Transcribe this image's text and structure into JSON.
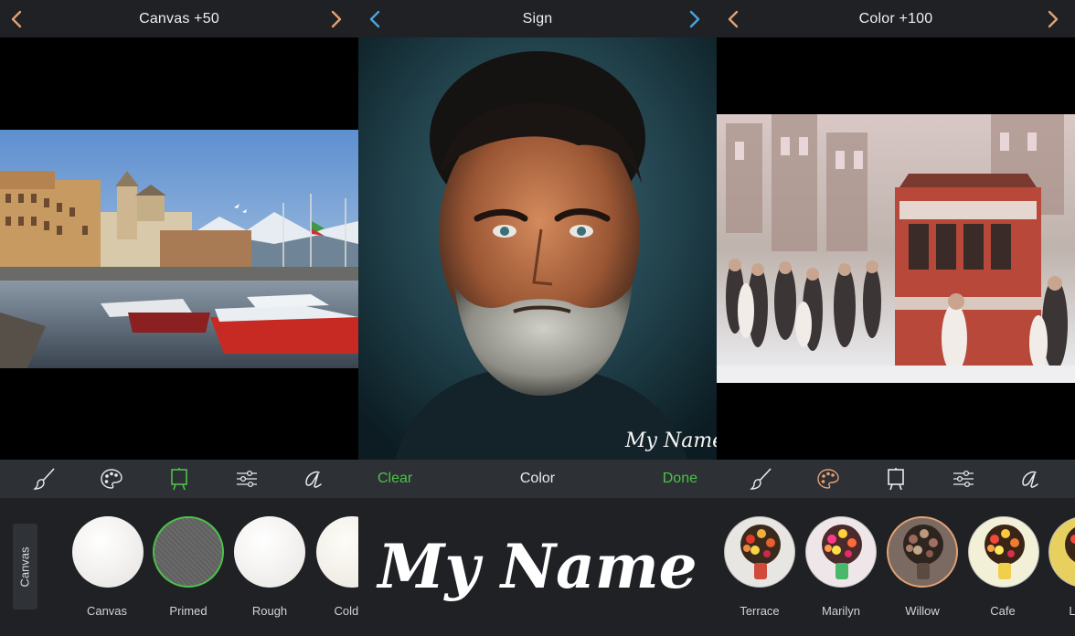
{
  "panels": {
    "canvas": {
      "title": "Canvas +50",
      "tools": [
        "brush-tool",
        "palette-tool",
        "canvas-tool",
        "adjust-tool",
        "sign-tool"
      ],
      "tray_tab": "Canvas",
      "options": [
        {
          "label": "Canvas",
          "selected": false
        },
        {
          "label": "Primed",
          "selected": true
        },
        {
          "label": "Rough",
          "selected": false
        },
        {
          "label": "Cold P",
          "selected": false
        }
      ]
    },
    "sign": {
      "title": "Sign",
      "clear_label": "Clear",
      "color_label": "Color",
      "done_label": "Done",
      "signature_text": "My Name"
    },
    "color": {
      "title": "Color +100",
      "options": [
        {
          "label": "Terrace",
          "selected": false
        },
        {
          "label": "Marilyn",
          "selected": false
        },
        {
          "label": "Willow",
          "selected": true
        },
        {
          "label": "Cafe",
          "selected": false
        },
        {
          "label": "L",
          "selected": false
        }
      ]
    }
  },
  "colors": {
    "accent_orange": "#e2a174",
    "accent_blue": "#4aa3df",
    "accent_green": "#4cc24a",
    "bar_dark": "#1f2124",
    "toolbar": "#2d3034"
  }
}
